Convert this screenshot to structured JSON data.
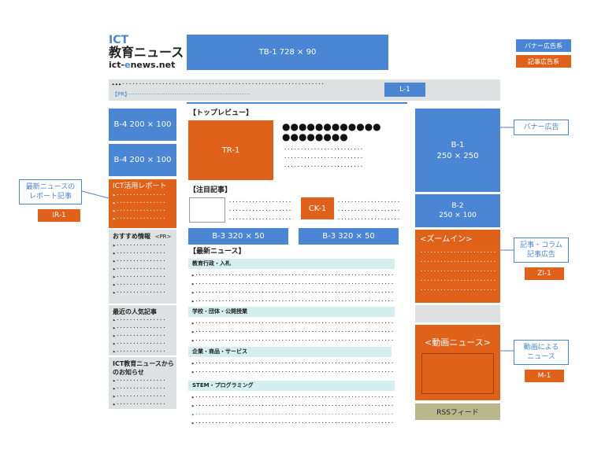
{
  "logo": {
    "line1": "ICT",
    "line2": "教育ニュース",
    "line3a": "ict-",
    "line3b": "e",
    "line3c": "news.net"
  },
  "legend": {
    "banner": "バナー広告系",
    "article": "記事広告系"
  },
  "tb1": "TB-1  728 × 90",
  "l1": {
    "dots": "▸▸▸·····································································",
    "pr": "【PR】",
    "label": "L-1"
  },
  "left": {
    "b4a": "B-4  200 × 100",
    "b4b": "B-4  200 × 100",
    "report": {
      "title": "ICT活用レポート",
      "lines": [
        "▸···············",
        "▸···············",
        "▸···············",
        "▸···············"
      ]
    },
    "osusume": {
      "title": "おすすめ情報",
      "pr": "<PR>",
      "lines": [
        "▸···············",
        "▸···············",
        "▸···············",
        "▸···············",
        "▸···············",
        "▸···············",
        "▸···············"
      ]
    },
    "popular": {
      "title": "最近の人気記事",
      "lines": [
        "▸···············",
        "▸···············",
        "▸···············",
        "▸···············",
        "▸···············"
      ]
    },
    "notice": {
      "title1": "ICT教育ニュースから",
      "title2": "のお知らせ",
      "lines": [
        "▸···············",
        "▸···············",
        "▸···············",
        "▸···············"
      ]
    }
  },
  "center": {
    "top_review": "【トップレビュー】",
    "tr1": "TR-1",
    "dots_big1": "●●●●●●●●●●●●",
    "dots_big2": "●●●●●●●●",
    "tr_lines": [
      "························",
      "························",
      "························"
    ],
    "chumoku": "【注目記事】",
    "ck_lines_left": [
      "·····················",
      "·····················",
      "·····················"
    ],
    "ck1": "CK-1",
    "ck_lines_right": [
      "·····················",
      "·····················",
      "·····················"
    ],
    "b3a": "B-3  320 × 50",
    "b3b": "B-3  320 × 50",
    "latest": "【最新ニュース】",
    "sections": [
      {
        "title": "教育行政・入札"
      },
      {
        "title": "学校・団体・公開授業"
      },
      {
        "title": "企業・商品・サービス"
      },
      {
        "title": "STEM・プログラミング"
      }
    ],
    "news_line": "▸·······································································"
  },
  "right": {
    "b1a": "B-1",
    "b1b": "250 × 250",
    "b2a": "B-2",
    "b2b": "250 × 100",
    "zoom": "<ズームイン>",
    "zoom_line": "·······················",
    "douga": "<動画ニュース>",
    "rss": "RSSフィード"
  },
  "callouts": {
    "banner": "バナー広告",
    "kiji1": "記事・コラム",
    "kiji2": "記事広告",
    "zi1": "ZI-1",
    "douga1": "動画による",
    "douga2": "ニュース",
    "m1": "M-1",
    "report1": "最新ニュースの",
    "report2": "レポート記事",
    "ir1": "IR-1"
  },
  "colors": {
    "banner": "#4a86d4",
    "article": "#e0611a",
    "panel": "#dde1e1",
    "section": "#d5eeee",
    "rss": "#b8b88c"
  }
}
